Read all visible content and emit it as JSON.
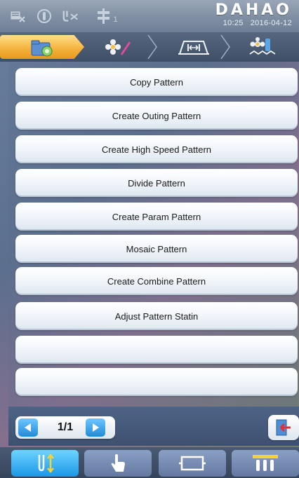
{
  "status": {
    "brand": "DAHAO",
    "time": "10:25",
    "date": "2016-04-12",
    "indicator_label": "1",
    "icons": [
      "pattern-disk-icon",
      "needle-position-icon",
      "thread-cut-icon",
      "frame-indicator-icon"
    ]
  },
  "tabs": [
    {
      "icon": "pattern-folder-icon",
      "active": true
    },
    {
      "icon": "flower-edit-icon",
      "active": false
    },
    {
      "icon": "frame-stretch-icon",
      "active": false
    },
    {
      "icon": "embroidery-machine-icon",
      "active": false
    }
  ],
  "menu": {
    "items": [
      "Copy Pattern",
      "Create Outing Pattern",
      "Create High Speed Pattern",
      "Divide Pattern",
      "Create Param Pattern",
      "Mosaic Pattern",
      "Create Combine Pattern",
      "Adjust Pattern Statin",
      "",
      ""
    ]
  },
  "pager": {
    "page": "1/1"
  },
  "bottom_nav": [
    {
      "icon": "needle-updown-icon",
      "active": true
    },
    {
      "icon": "hand-pointer-icon",
      "active": false
    },
    {
      "icon": "frame-rectangle-icon",
      "active": false
    },
    {
      "icon": "needle-bar-icon",
      "active": false
    }
  ],
  "colors": {
    "tab_active": "#f4b03a",
    "accent_blue": "#1f8bd8",
    "exit_red": "#e0303a"
  }
}
